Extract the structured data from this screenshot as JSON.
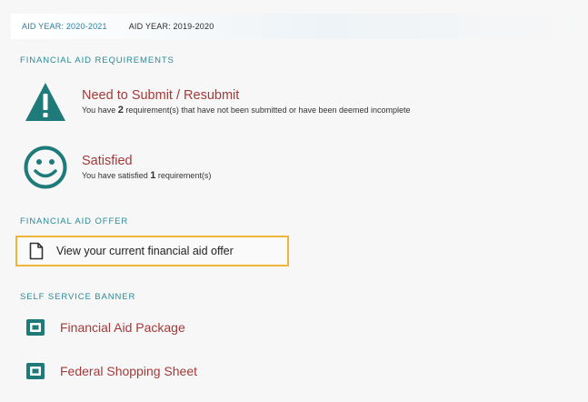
{
  "tabs": [
    {
      "label": "AID YEAR: 2020-2021",
      "active": false
    },
    {
      "label": "AID YEAR: 2019-2020",
      "active": true
    }
  ],
  "requirements": {
    "section_title": "FINANCIAL AID REQUIREMENTS",
    "need_submit": {
      "heading": "Need to Submit / Resubmit",
      "desc_prefix": "You have ",
      "count": "2",
      "desc_suffix": " requirement(s) that have not been submitted or have been deemed incomplete"
    },
    "satisfied": {
      "heading": "Satisfied",
      "desc_prefix": "You have satisfied ",
      "count": "1",
      "desc_suffix": " requirement(s)"
    }
  },
  "offer": {
    "section_title": "FINANCIAL AID OFFER",
    "link_label": "View your current financial aid offer"
  },
  "self_service": {
    "section_title": "SELF SERVICE BANNER",
    "items": [
      {
        "label": "Financial Aid Package"
      },
      {
        "label": "Federal Shopping Sheet"
      }
    ]
  },
  "colors": {
    "teal": "#1f7a7a",
    "heading_red": "#a33a3a",
    "highlight_border": "#f0b43a"
  },
  "icons": {
    "warning": "warning-triangle-icon",
    "smiley": "smiley-face-icon",
    "document": "document-icon",
    "banner": "banner-screen-icon"
  }
}
